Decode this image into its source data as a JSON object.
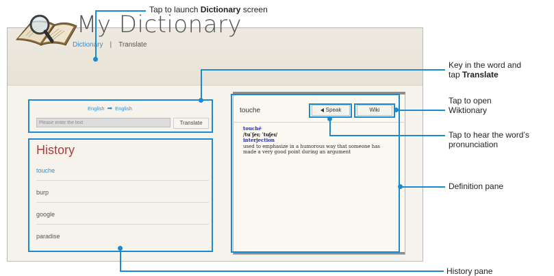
{
  "app": {
    "title": "My Dictionary",
    "nav": {
      "dictionary": "Dictionary",
      "separator": "|",
      "translate": "Translate"
    }
  },
  "translate_panel": {
    "source_language": "English",
    "target_language": "English",
    "arrow": "➡",
    "input_placeholder": "Please enter the text",
    "translate_button": "Translate"
  },
  "history": {
    "title": "History",
    "items": [
      "touche",
      "burp",
      "google",
      "paradise"
    ],
    "active_index": 0
  },
  "definition": {
    "word": "touche",
    "speak_button": "Speak",
    "wiki_button": "Wiki",
    "headword": "touché",
    "pronunciation": "/tu ̍ʃeɪ; ˈtuʃeɪ/",
    "part_of_speech": "interjection",
    "meaning": "used to emphasize in a humorous way that someone has made a very good point during an argument"
  },
  "annotations": {
    "dictionary_pre": "Tap to launch ",
    "dictionary_bold": "Dictionary",
    "dictionary_post": " screen",
    "translate_line1": "Key in the word and",
    "translate_pre": "tap ",
    "translate_bold": "Translate",
    "wiki_line1": "Tap to open",
    "wiki_line2": "Wiktionary",
    "speak_line1": "Tap to hear the word’s",
    "speak_line2": "pronunciation",
    "definition": "Definition pane",
    "history": "History pane"
  },
  "colors": {
    "callout": "#1a8ad0",
    "link": "#2f8fd0",
    "history_title": "#b23b3b"
  }
}
